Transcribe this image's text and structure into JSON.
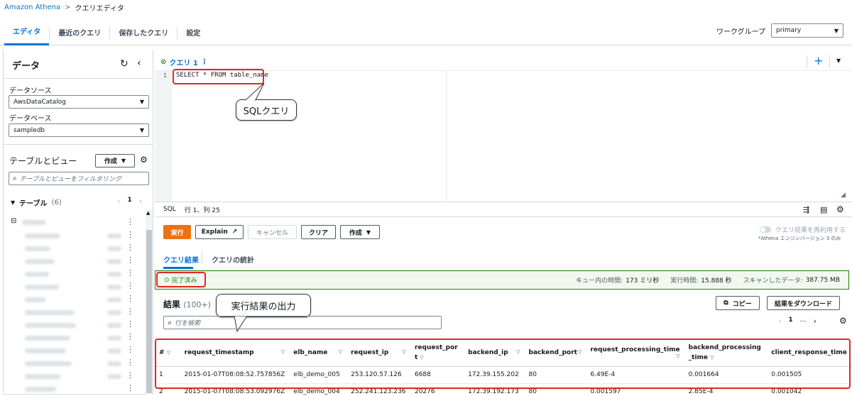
{
  "breadcrumb": {
    "root": "Amazon Athena",
    "separator": ">",
    "current": "クエリエディタ"
  },
  "tabs": [
    {
      "label": "エディタ"
    },
    {
      "label": "最近のクエリ"
    },
    {
      "label": "保存したクエリ"
    },
    {
      "label": "設定"
    }
  ],
  "workgroup": {
    "label": "ワークグループ",
    "value": "primary"
  },
  "left_panel": {
    "title": "データ",
    "datasource_label": "データソース",
    "datasource_value": "AwsDataCatalog",
    "database_label": "データベース",
    "database_value": "sampledb",
    "tables_views_title": "テーブルとビュー",
    "create_label": "作成",
    "filter_placeholder": "テーブルとビューをフィルタリング",
    "tables_section": {
      "label": "テーブル",
      "count": "(6)",
      "page": "1"
    }
  },
  "editor": {
    "query_tab": "クエリ 1",
    "line_number": "1",
    "sql": "SELECT * FROM table_name",
    "callout": "SQLクエリ",
    "statusbar_lang": "SQL",
    "statusbar_pos": "行 1、列 25"
  },
  "actions": {
    "run": "実行",
    "explain": "Explain",
    "cancel": "キャンセル",
    "clear": "クリア",
    "create": "作成",
    "reuse_label": "クエリ結果を再利用する",
    "reuse_note": "*Athena エンジンバージョン 3 のみ"
  },
  "result_tabs": {
    "results": "クエリ結果",
    "stats": "クエリの統計"
  },
  "status": {
    "text": "完了済み",
    "queue_label": "キュー内の時間:",
    "queue_value": "173 ミリ秒",
    "exec_label": "実行時間:",
    "exec_value": "15.888 秒",
    "scan_label": "スキャンしたデータ:",
    "scan_value": "387.75 MB"
  },
  "results": {
    "title": "結果",
    "count": "(100+)",
    "callout": "実行結果の出力",
    "search_placeholder": "行を検索",
    "copy_label": "コピー",
    "download_label": "結果をダウンロード",
    "page": "1",
    "ellipsis": "…",
    "columns": [
      "#",
      "request_timestamp",
      "elb_name",
      "request_ip",
      "request_port",
      "backend_ip",
      "backend_port",
      "request_processing_time",
      "backend_processing_time",
      "client_response_time"
    ],
    "rows": [
      [
        "1",
        "2015-01-07T08:08:52.757856Z",
        "elb_demo_005",
        "253.120.57.126",
        "6688",
        "172.39.155.202",
        "80",
        "6.49E-4",
        "0.001664",
        "0.001505"
      ],
      [
        "2",
        "2015-01-07T08:08:53.092976Z",
        "elb_demo_004",
        "252.241.123.236",
        "20276",
        "172.39.192.173",
        "80",
        "0.001597",
        "2.85E-4",
        "0.001042"
      ]
    ]
  },
  "colors": {
    "accent": "#0972d3",
    "run": "#ec7211",
    "highlight": "#e5251e",
    "success": "#1d8102"
  }
}
